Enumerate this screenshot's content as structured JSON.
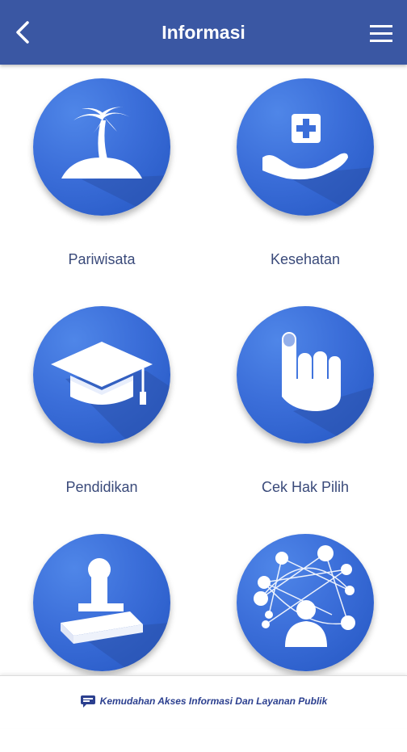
{
  "header": {
    "title": "Informasi",
    "back_icon": "chevron-left-icon",
    "menu_icon": "hamburger-menu-icon",
    "background_color": "#3a57a3"
  },
  "tiles": [
    {
      "label": "Pariwisata",
      "icon": "island-palm-icon"
    },
    {
      "label": "Kesehatan",
      "icon": "hand-medical-icon"
    },
    {
      "label": "Pendidikan",
      "icon": "graduation-cap-icon"
    },
    {
      "label": "Cek Hak Pilih",
      "icon": "inked-finger-icon"
    },
    {
      "label": "",
      "icon": "stamp-icon"
    },
    {
      "label": "",
      "icon": "network-people-icon"
    }
  ],
  "footer": {
    "text": "Kemudahan Akses Informasi Dan Layanan Publik",
    "icon": "chat-bubble-icon"
  },
  "colors": {
    "circle": "#3b6ed9",
    "label": "#3a4a7a",
    "footer_text": "#2b3f8f"
  }
}
